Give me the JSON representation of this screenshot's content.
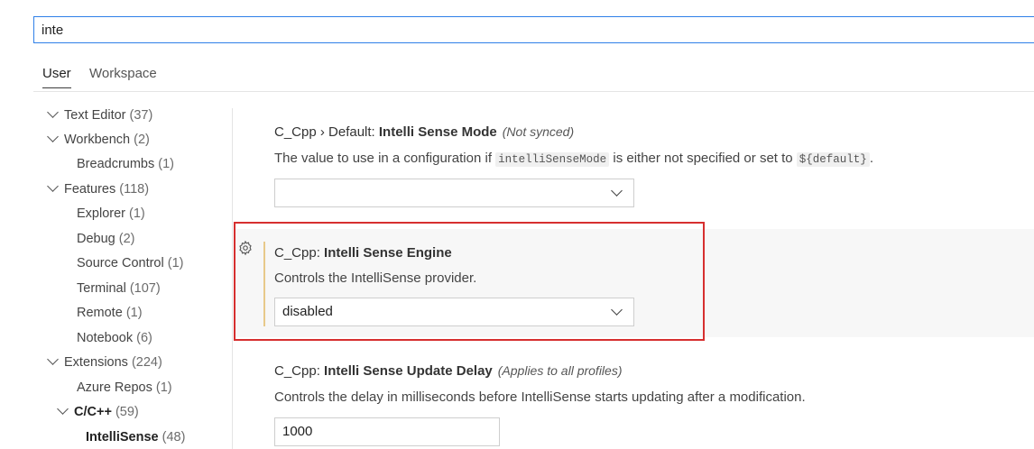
{
  "search": {
    "value": "inte"
  },
  "tabs": [
    {
      "label": "User"
    },
    {
      "label": "Workspace"
    }
  ],
  "tree": [
    {
      "label": "Text Editor",
      "count": "(37)"
    },
    {
      "label": "Workbench",
      "count": "(2)"
    },
    {
      "label": "Breadcrumbs",
      "count": "(1)"
    },
    {
      "label": "Features",
      "count": "(118)"
    },
    {
      "label": "Explorer",
      "count": "(1)"
    },
    {
      "label": "Debug",
      "count": "(2)"
    },
    {
      "label": "Source Control",
      "count": "(1)"
    },
    {
      "label": "Terminal",
      "count": "(107)"
    },
    {
      "label": "Remote",
      "count": "(1)"
    },
    {
      "label": "Notebook",
      "count": "(6)"
    },
    {
      "label": "Extensions",
      "count": "(224)"
    },
    {
      "label": "Azure Repos",
      "count": "(1)"
    },
    {
      "label": "C/C++",
      "count": "(59)"
    },
    {
      "label": "IntelliSense",
      "count": "(48)"
    }
  ],
  "settings": {
    "default_mode": {
      "category": "C_Cpp › Default: ",
      "name": "Intelli Sense Mode",
      "note": "(Not synced)",
      "desc_pre": "The value to use in a configuration if ",
      "code1": "intelliSenseMode",
      "desc_mid": " is either not specified or set to ",
      "code2": "${default}",
      "desc_post": ".",
      "value": ""
    },
    "engine": {
      "category": "C_Cpp: ",
      "name": "Intelli Sense Engine",
      "desc": "Controls the IntelliSense provider.",
      "value": "disabled"
    },
    "update_delay": {
      "category": "C_Cpp: ",
      "name": "Intelli Sense Update Delay",
      "note": "(Applies to all profiles)",
      "desc": "Controls the delay in milliseconds before IntelliSense starts updating after a modification.",
      "value": "1000"
    }
  },
  "icons": {
    "gear": "gear-icon",
    "chevron": "chevron-down-icon"
  },
  "colors": {
    "focus_border": "#2f80e8",
    "highlight_box": "#d62f2f",
    "modified_bar": "#e8c98a"
  }
}
